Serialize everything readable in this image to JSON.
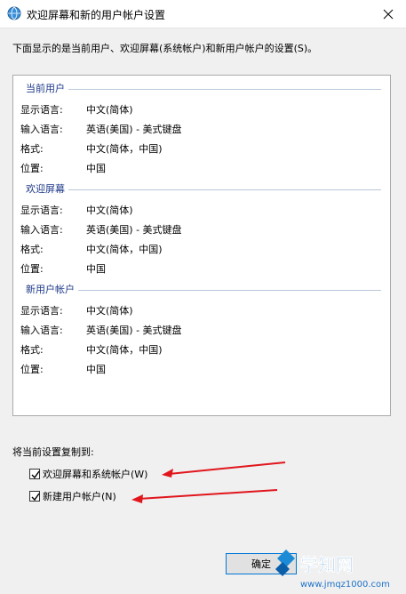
{
  "window": {
    "title": "欢迎屏幕和新的用户帐户设置"
  },
  "intro_text": "下面显示的是当前用户、欢迎屏幕(系统帐户)和新用户帐户的设置(S)。",
  "sections": [
    {
      "title": "当前用户",
      "rows": [
        {
          "label": "显示语言:",
          "value": "中文(简体)"
        },
        {
          "label": "输入语言:",
          "value": "英语(美国) - 美式键盘"
        },
        {
          "label": "格式:",
          "value": "中文(简体，中国)"
        },
        {
          "label": "位置:",
          "value": "中国"
        }
      ]
    },
    {
      "title": "欢迎屏幕",
      "rows": [
        {
          "label": "显示语言:",
          "value": "中文(简体)"
        },
        {
          "label": "输入语言:",
          "value": "英语(美国) - 美式键盘"
        },
        {
          "label": "格式:",
          "value": "中文(简体，中国)"
        },
        {
          "label": "位置:",
          "value": "中国"
        }
      ]
    },
    {
      "title": "新用户帐户",
      "rows": [
        {
          "label": "显示语言:",
          "value": "中文(简体)"
        },
        {
          "label": "输入语言:",
          "value": "英语(美国) - 美式键盘"
        },
        {
          "label": "格式:",
          "value": "中文(简体，中国)"
        },
        {
          "label": "位置:",
          "value": "中国"
        }
      ]
    }
  ],
  "copy": {
    "label": "将当前设置复制到:",
    "welcome_checkbox": {
      "label": "欢迎屏幕和系统帐户(W)",
      "checked": true
    },
    "newuser_checkbox": {
      "label": "新建用户帐户(N)",
      "checked": true
    }
  },
  "buttons": {
    "ok": "确定"
  },
  "watermark": {
    "brand": "学知网",
    "url": "www.jmqz1000.com"
  },
  "colors": {
    "section_title": "#1e3a8a",
    "annotation_arrow": "#e0161c",
    "ok_border": "#0078d7"
  },
  "icons": {
    "title": "globe-settings-icon",
    "close": "close-icon",
    "check": "check-icon"
  }
}
